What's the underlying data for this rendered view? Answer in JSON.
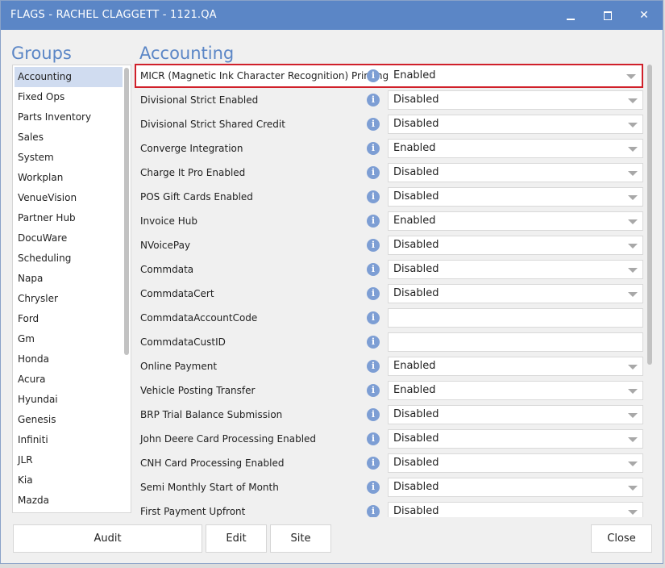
{
  "window": {
    "title": "FLAGS - RACHEL CLAGGETT - 1121.QA",
    "controls": [
      "minimize",
      "maximize",
      "close"
    ]
  },
  "groups": {
    "heading": "Groups",
    "items": [
      "Accounting",
      "Fixed Ops",
      "Parts Inventory",
      "Sales",
      "System",
      "Workplan",
      "VenueVision",
      "Partner Hub",
      "DocuWare",
      "Scheduling",
      "Napa",
      "Chrysler",
      "Ford",
      "Gm",
      "Honda",
      "Acura",
      "Hyundai",
      "Genesis",
      "Infiniti",
      "JLR",
      "Kia",
      "Mazda"
    ],
    "selected": "Accounting"
  },
  "accounting": {
    "heading": "Accounting",
    "flags": [
      {
        "label": "MICR (Magnetic Ink Character Recognition) Printing",
        "value": "Enabled",
        "kind": "select"
      },
      {
        "label": "Divisional Strict Enabled",
        "value": "Disabled",
        "kind": "select"
      },
      {
        "label": "Divisional Strict Shared Credit",
        "value": "Disabled",
        "kind": "select"
      },
      {
        "label": "Converge Integration",
        "value": "Enabled",
        "kind": "select"
      },
      {
        "label": "Charge It Pro Enabled",
        "value": "Disabled",
        "kind": "select"
      },
      {
        "label": "POS Gift Cards Enabled",
        "value": "Disabled",
        "kind": "select"
      },
      {
        "label": "Invoice Hub",
        "value": "Enabled",
        "kind": "select"
      },
      {
        "label": "NVoicePay",
        "value": "Disabled",
        "kind": "select"
      },
      {
        "label": "Commdata",
        "value": "Disabled",
        "kind": "select"
      },
      {
        "label": "CommdataCert",
        "value": "Disabled",
        "kind": "select"
      },
      {
        "label": "CommdataAccountCode",
        "value": "",
        "kind": "text"
      },
      {
        "label": "CommdataCustID",
        "value": "",
        "kind": "text"
      },
      {
        "label": "Online Payment",
        "value": "Enabled",
        "kind": "select"
      },
      {
        "label": "Vehicle Posting Transfer",
        "value": "Enabled",
        "kind": "select"
      },
      {
        "label": "BRP Trial Balance Submission",
        "value": "Disabled",
        "kind": "select"
      },
      {
        "label": "John Deere Card Processing Enabled",
        "value": "Disabled",
        "kind": "select"
      },
      {
        "label": "CNH Card Processing Enabled",
        "value": "Disabled",
        "kind": "select"
      },
      {
        "label": "Semi Monthly Start of Month",
        "value": "Disabled",
        "kind": "select"
      },
      {
        "label": "First Payment Upfront",
        "value": "Disabled",
        "kind": "select"
      }
    ]
  },
  "buttons": {
    "audit": "Audit",
    "edit": "Edit",
    "site": "Site",
    "close": "Close"
  },
  "info_icon_glyph": "i",
  "colors": {
    "accent": "#5b86c6",
    "highlight_border": "#d0202a",
    "selected_item": "#d0dcf0"
  }
}
